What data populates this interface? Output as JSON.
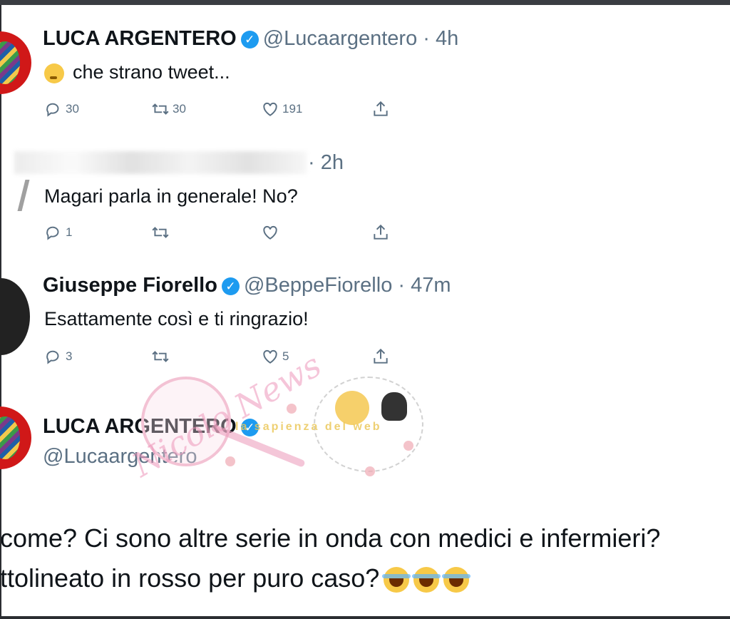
{
  "tweets": [
    {
      "name": "LUCA ARGENTERO",
      "handle_time": "@Lucaargentero · 4h",
      "text": "che strano tweet...",
      "reply_count": "30",
      "retweet_count": "30",
      "like_count": "191"
    },
    {
      "name": "",
      "handle_time": "· 2h",
      "text": "Magari parla in generale! No?",
      "reply_count": "1",
      "retweet_count": "",
      "like_count": ""
    },
    {
      "name": "Giuseppe Fiorello",
      "handle_time": "@BeppeFiorello · 47m",
      "text": "Esattamente così e ti ringrazio!",
      "reply_count": "3",
      "retweet_count": "",
      "like_count": "5"
    }
  ],
  "final_tweet": {
    "name": "LUCA ARGENTERO",
    "handle": "@Lucaargentero",
    "line1": "come? Ci sono altre serie in onda con medici e infermieri?",
    "line2": "ttolineato in rosso per puro caso?"
  },
  "watermark": {
    "script_text": "Nicolo News",
    "banner_text": "la sapienza del web"
  },
  "icons": {
    "reply": "reply-icon",
    "retweet": "retweet-icon",
    "like": "heart-icon",
    "share": "share-icon",
    "verified": "verified-badge-icon"
  },
  "colors": {
    "verified": "#1d9bf0",
    "handle": "#5b7083",
    "text": "#0f1419"
  }
}
